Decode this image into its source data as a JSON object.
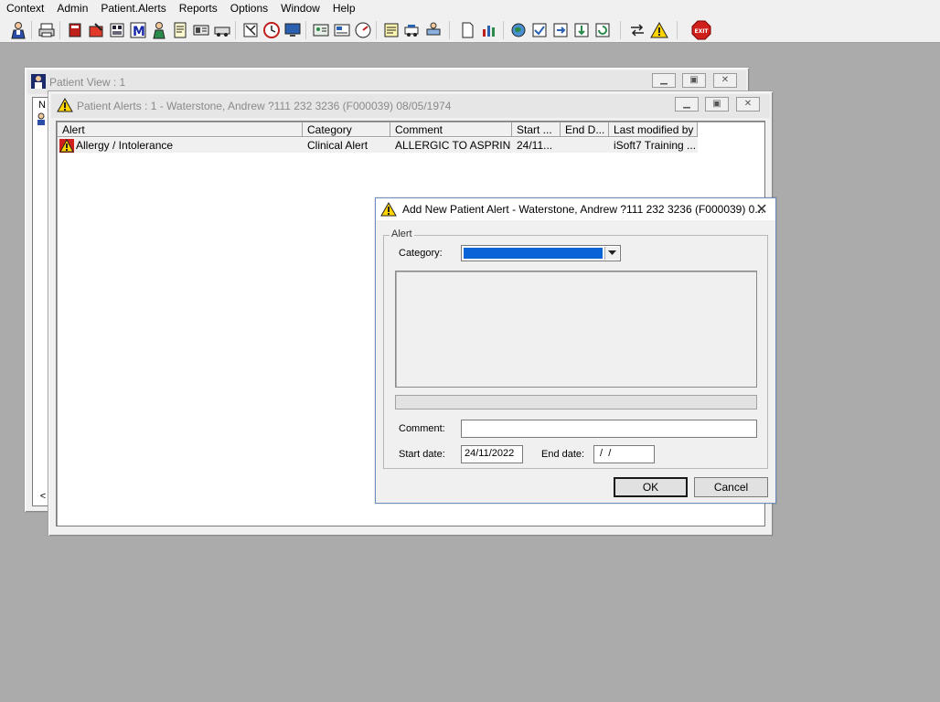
{
  "menu": [
    "Context",
    "Admin",
    "Patient.Alerts",
    "Reports",
    "Options",
    "Window",
    "Help"
  ],
  "toolbar": {
    "exit_label": "EXIT"
  },
  "patient_view": {
    "title": "Patient View : 1",
    "column_fragment": "N",
    "scroll_left": "<"
  },
  "patient_alerts": {
    "title": "Patient Alerts : 1 - Waterstone, Andrew ?111 232 3236 (F000039) 08/05/1974",
    "columns": [
      "Alert",
      "Category",
      "Comment",
      "Start ...",
      "End D...",
      "Last modified by"
    ],
    "rows": [
      {
        "alert": "Allergy / Intolerance",
        "category": "Clinical Alert",
        "comment": "ALLERGIC TO ASPRIN",
        "start": "24/11...",
        "end": "",
        "modified_by": "iSoft7 Training ..."
      }
    ]
  },
  "dialog": {
    "title": "Add New Patient Alert - Waterstone, Andrew ?111 232 3236 (F000039) 0...",
    "group_label": "Alert",
    "category_label": "Category:",
    "category_value": "",
    "comment_label": "Comment:",
    "comment_value": "",
    "start_date_label": "Start date:",
    "start_date_value": "24/11/2022",
    "end_date_label": "End date:",
    "end_date_value": " /  /",
    "ok_label": "OK",
    "cancel_label": "Cancel",
    "close_glyph": "✕"
  },
  "colors": {
    "desktop": "#ababab",
    "selection": "#0a64d8",
    "warning": "#ffd400"
  }
}
